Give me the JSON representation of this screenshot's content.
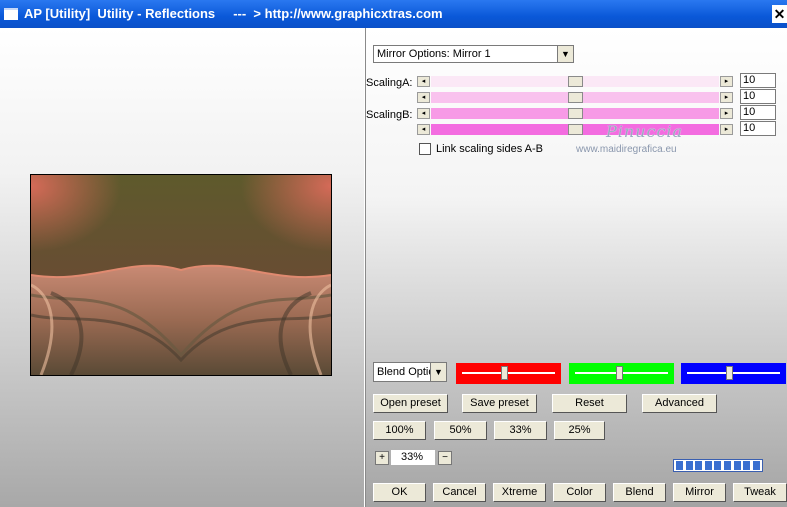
{
  "window": {
    "title": "AP [Utility]  Utility - Reflections     ---  > http://www.graphicxtras.com",
    "close_glyph": "✕"
  },
  "mirror": {
    "selected": "Mirror Options: Mirror 1"
  },
  "scaling": {
    "label_a": "ScalingA:",
    "label_b": "ScalingB:",
    "sliders": [
      {
        "value": "10",
        "level": 0.5,
        "color": "#fbe8f6"
      },
      {
        "value": "10",
        "level": 0.5,
        "color": "#f9c2ee"
      },
      {
        "value": "10",
        "level": 0.5,
        "color": "#f79ae6"
      },
      {
        "value": "10",
        "level": 0.5,
        "color": "#f36ce0"
      }
    ],
    "link_label": "Link scaling sides A-B",
    "link_checked": false
  },
  "watermark": {
    "name": "Pinuccia",
    "site": "www.maidiregrafica.eu"
  },
  "blend": {
    "selected": "Blend Optio"
  },
  "color_sliders": [
    {
      "color": "#ff0000",
      "level": 0.45
    },
    {
      "color": "#00ff00",
      "level": 0.47
    },
    {
      "color": "#0000ff",
      "level": 0.45
    }
  ],
  "preset_buttons": [
    "Open preset",
    "Save preset",
    "Reset",
    "Advanced"
  ],
  "zoom_buttons": [
    "100%",
    "50%",
    "33%",
    "25%"
  ],
  "zoom": {
    "plus": "+",
    "value": "33%",
    "minus": "−"
  },
  "progress": {
    "segments": 9
  },
  "bottom_buttons": [
    "OK",
    "Cancel",
    "Xtreme",
    "Color",
    "Blend",
    "Mirror",
    "Tweak"
  ]
}
